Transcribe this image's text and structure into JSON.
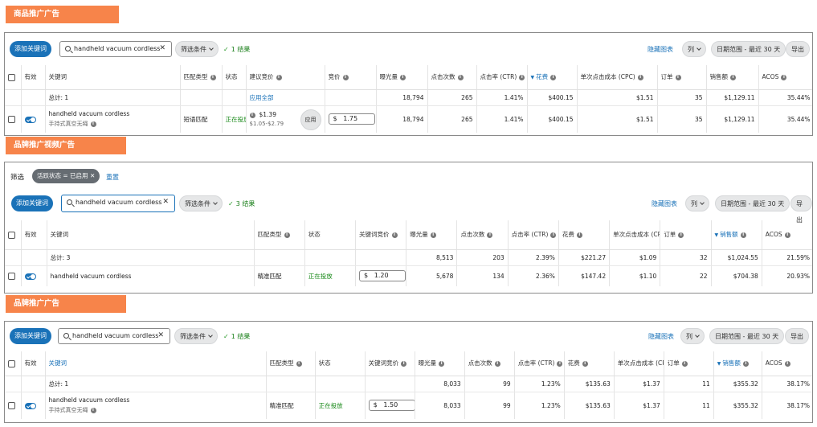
{
  "sections": [
    {
      "title": "商品推广广告",
      "add_btn": "添加关键词",
      "search_value": "handheld vacuum cordless",
      "filter_label": "筛选条件",
      "result_count": "1 结果",
      "hide_chart": "隐藏图表",
      "columns_btn": "列",
      "date_range": "日期范围 - 最近 30 天",
      "export_btn": "导出",
      "headers": {
        "active": "有效",
        "keyword": "关键词",
        "match_type": "匹配类型",
        "status": "状态",
        "suggested_bid": "建议竞价",
        "bid": "竞价",
        "impressions": "曝光量",
        "clicks": "点击次数",
        "ctr": "点击率 (CTR)",
        "spend": "花费",
        "cpc": "单次点击成本 (CPC)",
        "orders": "订单",
        "sales": "销售额",
        "acos": "ACOS"
      },
      "total": {
        "label": "总计: 1",
        "apply_all": "应用全部",
        "impressions": "18,794",
        "clicks": "265",
        "ctr": "1.41%",
        "spend": "$400.15",
        "cpc": "$1.51",
        "orders": "35",
        "sales": "$1,129.11",
        "acos": "35.44%"
      },
      "row": {
        "keyword": "handheld vacuum cordless",
        "translation": "手持式真空无绳",
        "match_type": "短语匹配",
        "status": "正在投放",
        "suggested_bid": "$1.39",
        "suggested_range": "$1.05-$2.79",
        "apply": "应用",
        "bid_currency": "$",
        "bid": "1.75",
        "impressions": "18,794",
        "clicks": "265",
        "ctr": "1.41%",
        "spend": "$400.15",
        "cpc": "$1.51",
        "orders": "35",
        "sales": "$1,129.11",
        "acos": "35.44%"
      }
    },
    {
      "title": "品牌推广视频广告",
      "filter_bar_label": "筛选",
      "filter_chip": "活跃状态 = 已启用",
      "reset": "重置",
      "add_btn": "添加关键词",
      "search_value": "handheld vacuum cordless",
      "filter_label": "筛选条件",
      "result_count": "3 结果",
      "hide_chart": "隐藏图表",
      "columns_btn": "列",
      "date_range": "日期范围 - 最近 30 天",
      "export_btn": "导出",
      "headers": {
        "active": "有效",
        "keyword": "关键词",
        "match_type": "匹配类型",
        "status": "状态",
        "bid": "关键词竞价",
        "impressions": "曝光量",
        "clicks": "点击次数",
        "ctr": "点击率 (CTR)",
        "spend": "花费",
        "cpc": "单次点击成本 (CPC",
        "orders": "订单",
        "sales": "销售额",
        "acos": "ACOS"
      },
      "total": {
        "label": "总计: 3",
        "impressions": "8,513",
        "clicks": "203",
        "ctr": "2.39%",
        "spend": "$221.27",
        "cpc": "$1.09",
        "orders": "32",
        "sales": "$1,024.55",
        "acos": "21.59%"
      },
      "row": {
        "keyword": "handheld vacuum cordless",
        "match_type": "精准匹配",
        "status": "正在投放",
        "bid_currency": "$",
        "bid": "1.20",
        "impressions": "5,678",
        "clicks": "134",
        "ctr": "2.36%",
        "spend": "$147.42",
        "cpc": "$1.10",
        "orders": "22",
        "sales": "$704.38",
        "acos": "20.93%"
      }
    },
    {
      "title": "品牌推广广告",
      "add_btn": "添加关键词",
      "search_value": "handheld vacuum cordless",
      "filter_label": "筛选条件",
      "result_count": "1 结果",
      "hide_chart": "隐藏图表",
      "columns_btn": "列",
      "date_range": "日期范围 - 最近 30 天",
      "export_btn": "导出",
      "headers": {
        "active": "有效",
        "keyword": "关键词",
        "match_type": "匹配类型",
        "status": "状态",
        "bid": "关键词竞价",
        "impressions": "曝光量",
        "clicks": "点击次数",
        "ctr": "点击率 (CTR)",
        "spend": "花费",
        "cpc": "单次点击成本 (CPC",
        "orders": "订单",
        "sales": "销售额",
        "acos": "ACOS"
      },
      "total": {
        "label": "总计: 1",
        "impressions": "8,033",
        "clicks": "99",
        "ctr": "1.23%",
        "spend": "$135.63",
        "cpc": "$1.37",
        "orders": "11",
        "sales": "$355.32",
        "acos": "38.17%"
      },
      "row": {
        "keyword": "handheld vacuum cordless",
        "translation": "手持式真空无绳",
        "match_type": "精准匹配",
        "status": "正在投放",
        "bid_currency": "$",
        "bid": "1.50",
        "impressions": "8,033",
        "clicks": "99",
        "ctr": "1.23%",
        "spend": "$135.63",
        "cpc": "$1.37",
        "orders": "11",
        "sales": "$355.32",
        "acos": "38.17%"
      }
    }
  ],
  "colors": {
    "accent": "#1a72b8",
    "section_title_bg": "#f7844a",
    "status_green": "#1a8a1a"
  },
  "icons": [
    "search-icon",
    "clear-icon",
    "chevron-down-icon",
    "check-icon",
    "info-icon",
    "toggle-icon",
    "sort-desc-icon",
    "chip-close-icon"
  ]
}
